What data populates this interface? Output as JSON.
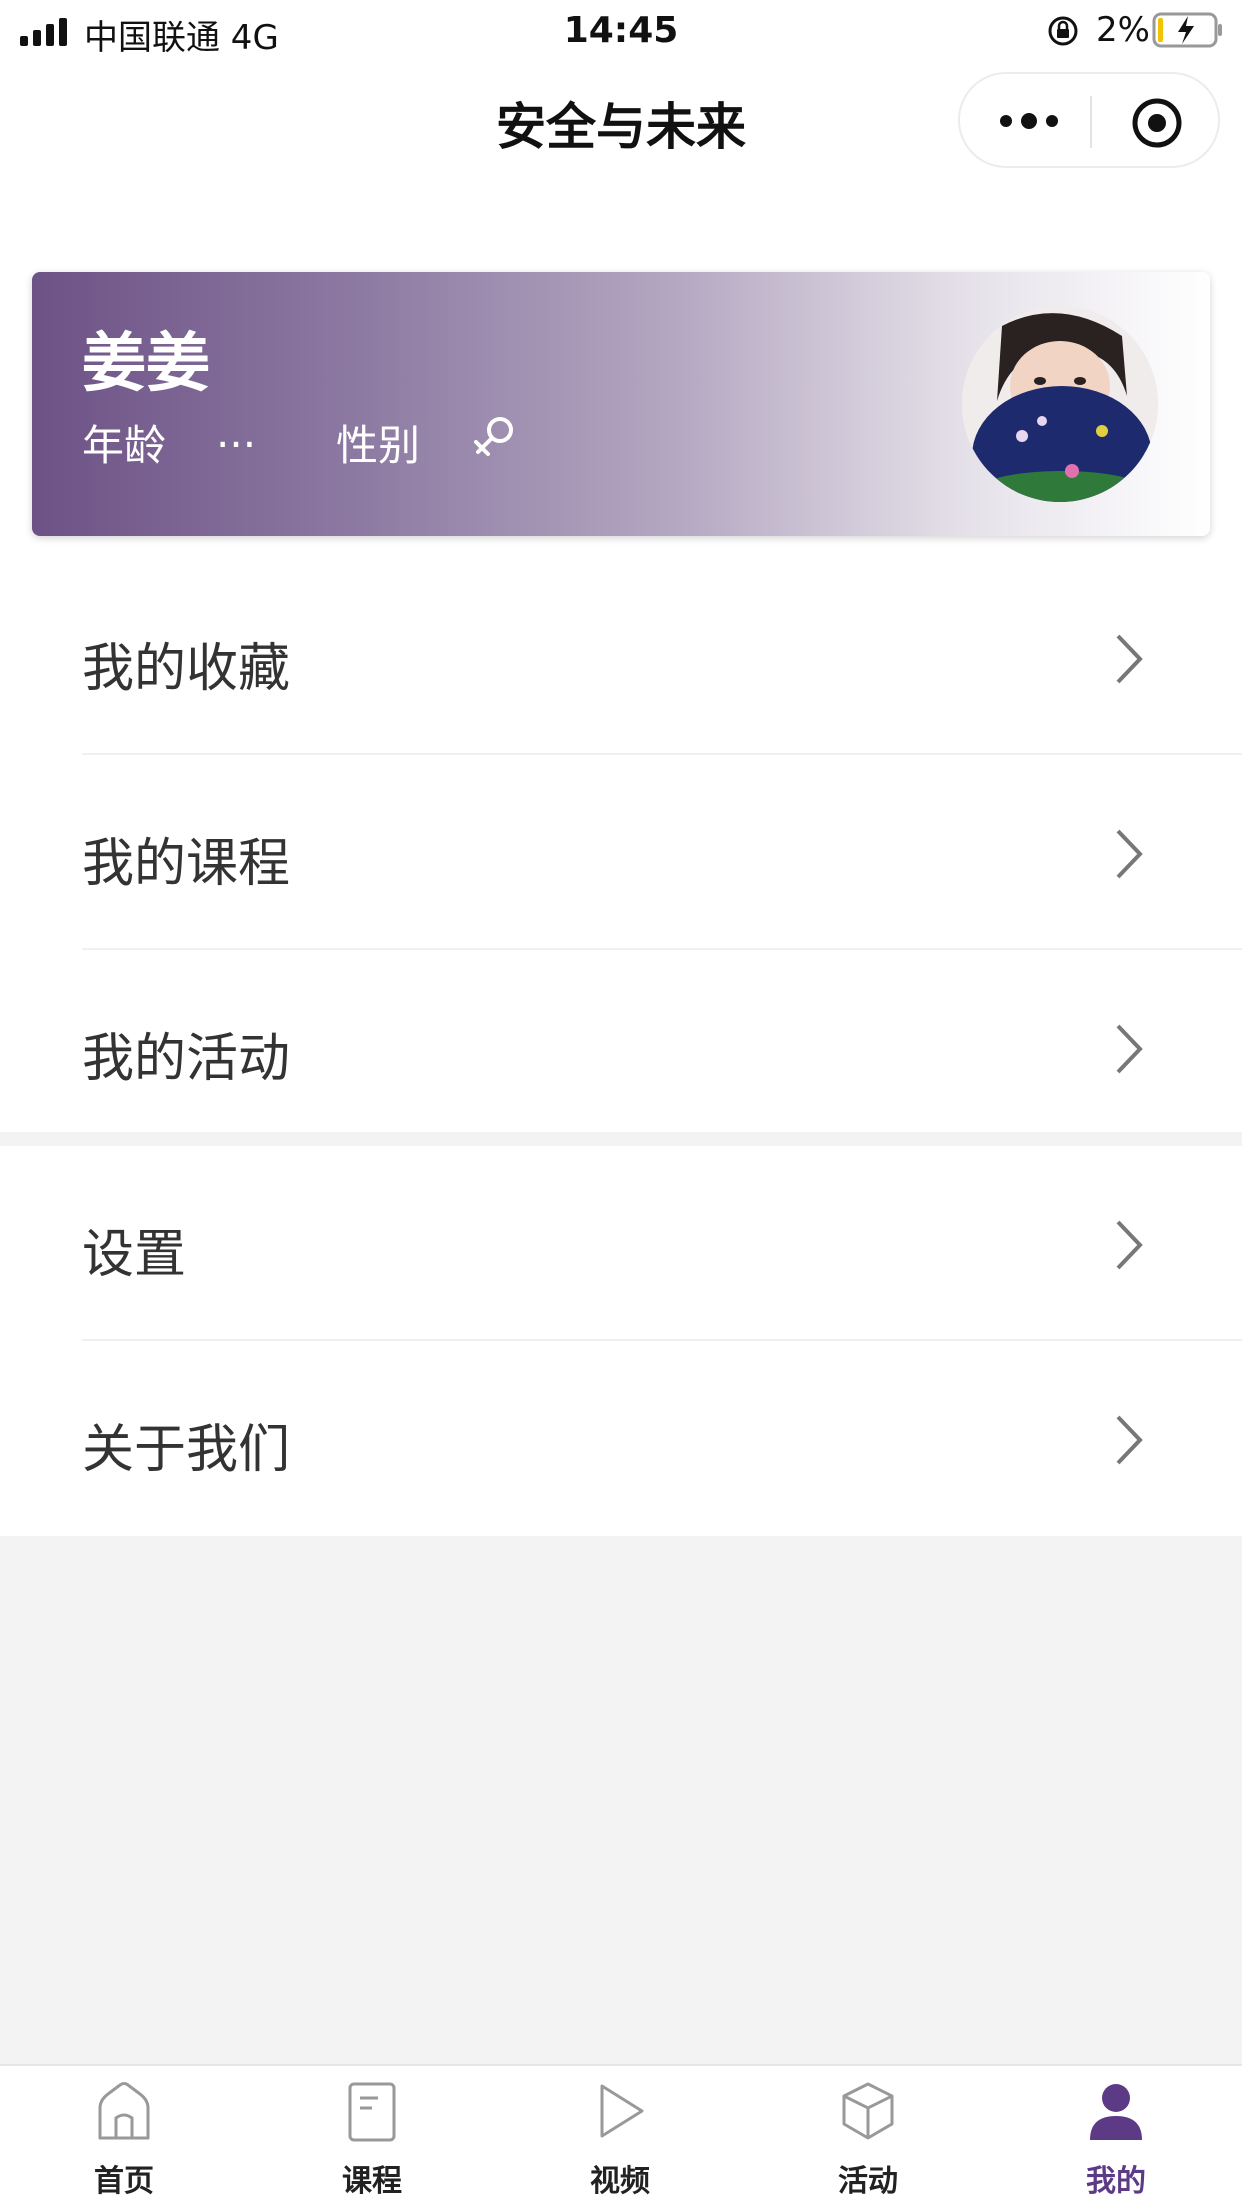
{
  "status_bar": {
    "carrier": "中国联通   4G",
    "time": "14:45",
    "battery": "2%"
  },
  "nav": {
    "title": "安全与未来"
  },
  "profile": {
    "name": "姜姜",
    "age_label": "年龄",
    "age_value": "...",
    "gender_label": "性别",
    "gender_icon": "female-icon"
  },
  "menu": {
    "group1": [
      {
        "label": "我的收藏"
      },
      {
        "label": "我的课程"
      },
      {
        "label": "我的活动"
      }
    ],
    "group2": [
      {
        "label": "设置"
      },
      {
        "label": "关于我们"
      }
    ]
  },
  "tabs": [
    {
      "label": "首页",
      "icon": "home-icon"
    },
    {
      "label": "课程",
      "icon": "book-icon"
    },
    {
      "label": "视频",
      "icon": "play-icon"
    },
    {
      "label": "活动",
      "icon": "box-icon"
    },
    {
      "label": "我的",
      "icon": "user-icon",
      "active": true
    }
  ],
  "colors": {
    "accent": "#5c3a86",
    "card_gradient_start": "#6d5286"
  }
}
